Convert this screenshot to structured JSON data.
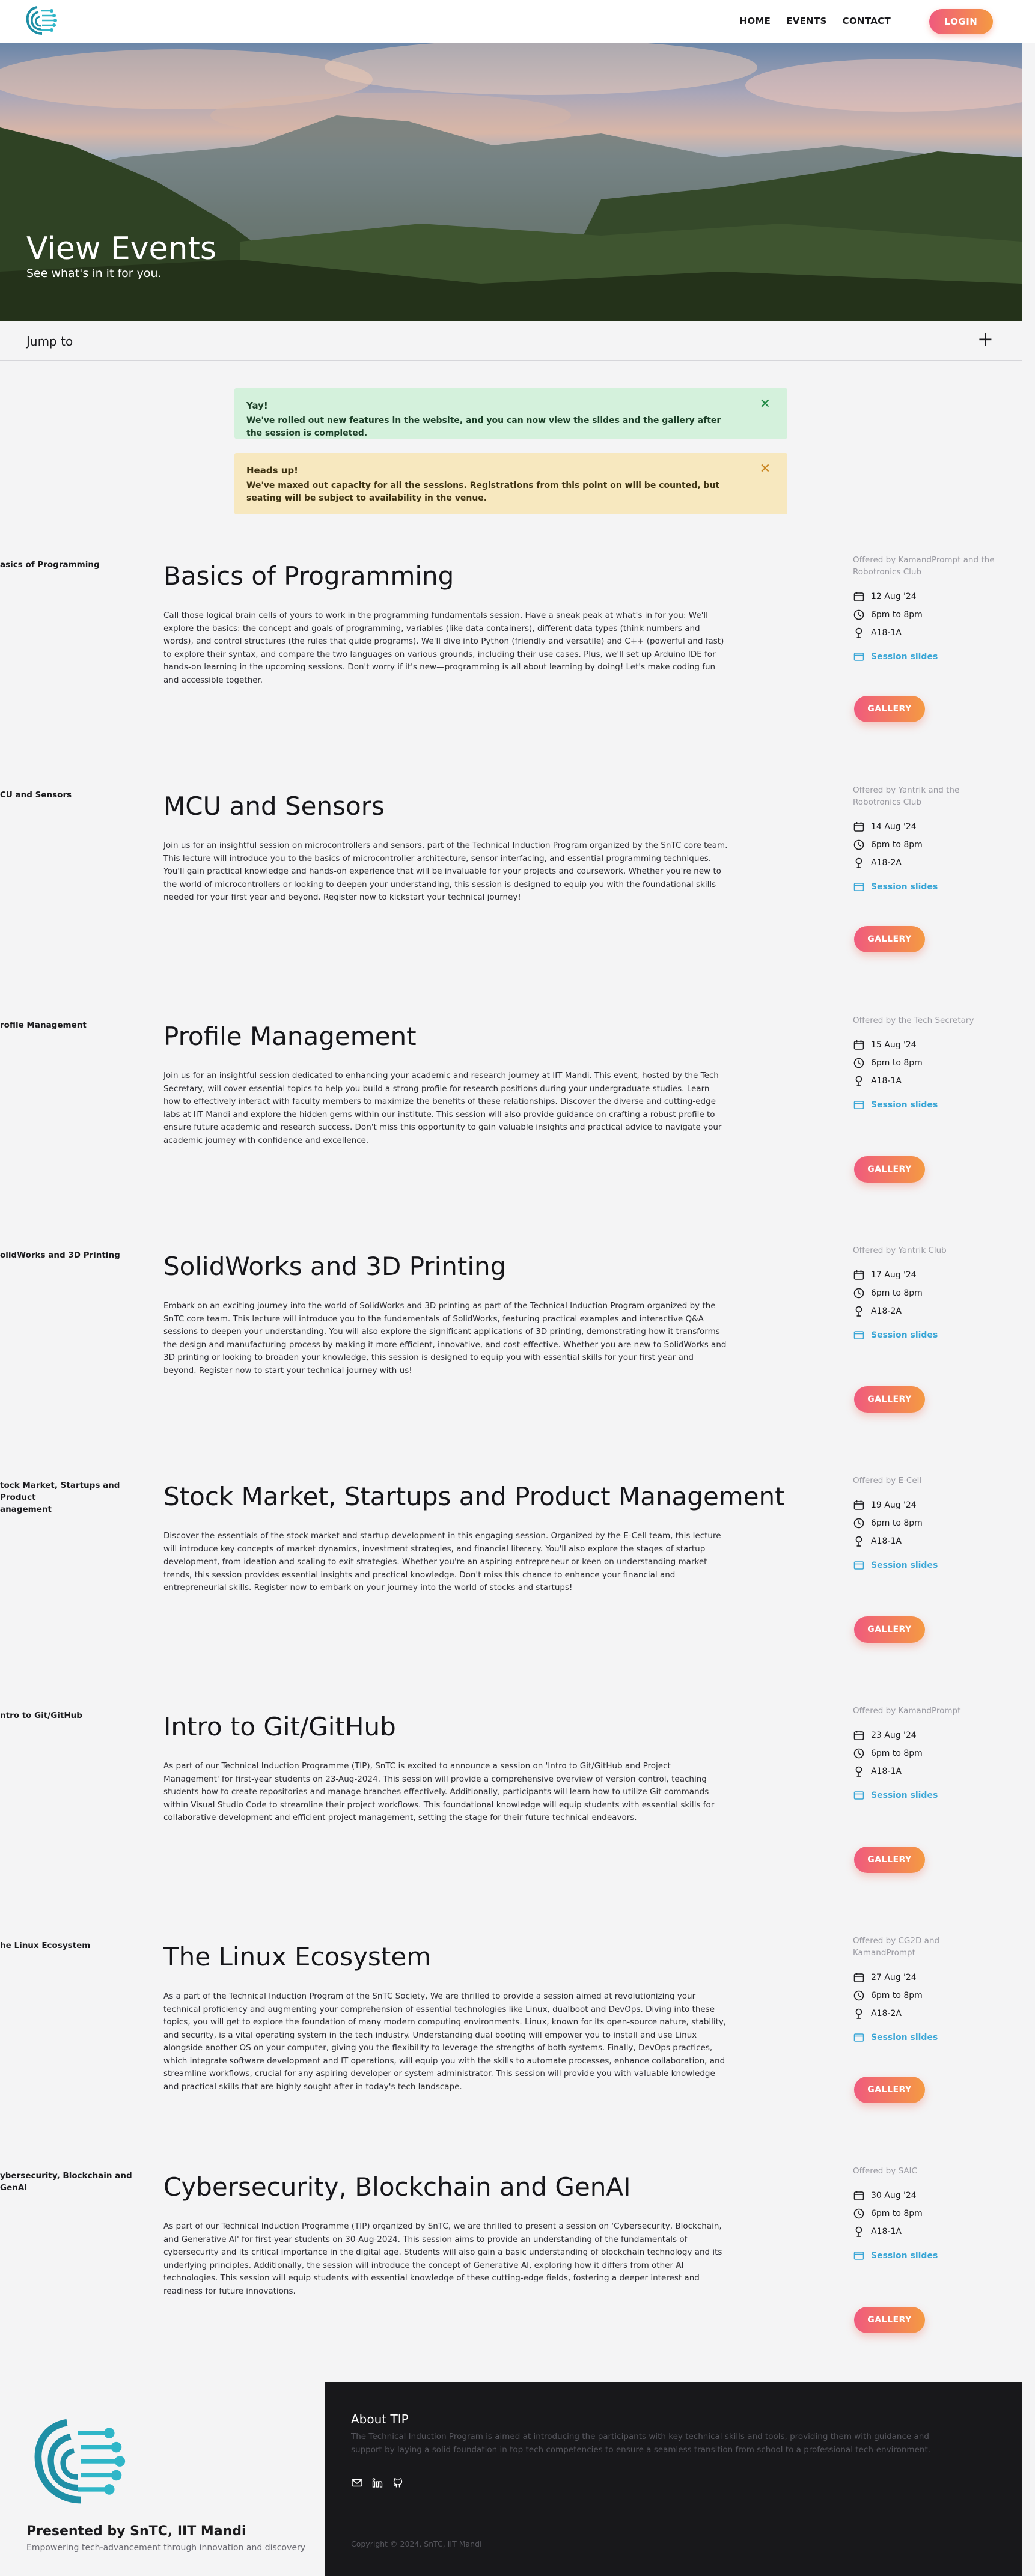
{
  "nav": {
    "links": [
      "HOME",
      "EVENTS",
      "CONTACT"
    ],
    "login_label": "LOGIN"
  },
  "hero": {
    "title": "View Events",
    "subtitle": "See what's in it for you."
  },
  "jump": {
    "label": "Jump to",
    "toggle": "+"
  },
  "alerts": {
    "success": {
      "title": "Yay!",
      "text": "We've rolled out new features in the website, and you can now view the slides and the gallery after the session is completed.",
      "close": "✕"
    },
    "warning": {
      "title": "Heads up!",
      "text": "We've maxed out capacity for all the sessions. Registrations from this point on will be counted, but seating will be subject to availability in the venue.",
      "close": "✕"
    }
  },
  "sessions": [
    {
      "side_label": "asics of Programming",
      "title": "Basics of Programming",
      "description": "Call those logical brain cells of yours to work in the programming fundamentals session. Have a sneak peak at what's in for you: We'll explore the basics: the concept and goals of programming, variables (like data containers), different data types (think numbers and words), and control structures (the rules that guide programs). We'll dive into Python (friendly and versatile) and C++ (powerful and fast) to explore their syntax, and compare the two languages on various grounds, including their use cases. Plus, we'll set up Arduino IDE for hands-on learning in the upcoming sessions. Don't worry if it's new—programming is all about learning by doing! Let's make coding fun and accessible together.",
      "offered_by": "Offered by KamandPrompt and the Robotronics Club",
      "date": "12 Aug '24",
      "time": "6pm to 8pm",
      "venue": "A18-1A",
      "slides_label": "Session slides",
      "gallery_label": "GALLERY"
    },
    {
      "side_label": "CU and Sensors",
      "title": "MCU and Sensors",
      "description": "Join us for an insightful session on microcontrollers and sensors, part of the Technical Induction Program organized by the SnTC core team. This lecture will introduce you to the basics of microcontroller architecture, sensor interfacing, and essential programming techniques. You'll gain practical knowledge and hands-on experience that will be invaluable for your projects and coursework. Whether you're new to the world of microcontrollers or looking to deepen your understanding, this session is designed to equip you with the foundational skills needed for your first year and beyond. Register now to kickstart your technical journey!",
      "offered_by": "Offered by Yantrik and the Robotronics Club",
      "date": "14 Aug '24",
      "time": "6pm to 8pm",
      "venue": "A18-2A",
      "slides_label": "Session slides",
      "gallery_label": "GALLERY"
    },
    {
      "side_label": "rofile Management",
      "title": "Profile Management",
      "description": "Join us for an insightful session dedicated to enhancing your academic and research journey at IIT Mandi. This event, hosted by the Tech Secretary, will cover essential topics to help you build a strong profile for research positions during your undergraduate studies. Learn how to effectively interact with faculty members to maximize the benefits of these relationships. Discover the diverse and cutting-edge labs at IIT Mandi and explore the hidden gems within our institute. This session will also provide guidance on crafting a robust profile to ensure future academic and research success. Don't miss this opportunity to gain valuable insights and practical advice to navigate your academic journey with confidence and excellence.",
      "offered_by": "Offered by the Tech Secretary",
      "date": "15 Aug '24",
      "time": "6pm to 8pm",
      "venue": "A18-1A",
      "slides_label": "Session slides",
      "gallery_label": "GALLERY"
    },
    {
      "side_label": "olidWorks and 3D Printing",
      "title": "SolidWorks and 3D Printing",
      "description": "Embark on an exciting journey into the world of SolidWorks and 3D printing as part of the Technical Induction Program organized by the SnTC core team. This lecture will introduce you to the fundamentals of SolidWorks, featuring practical examples and interactive Q&A sessions to deepen your understanding. You will also explore the significant applications of 3D printing, demonstrating how it transforms the design and manufacturing process by making it more efficient, innovative, and cost-effective. Whether you are new to SolidWorks and 3D printing or looking to broaden your knowledge, this session is designed to equip you with essential skills for your first year and beyond. Register now to start your technical journey with us!",
      "offered_by": "Offered by Yantrik Club",
      "date": "17 Aug '24",
      "time": "6pm to 8pm",
      "venue": "A18-2A",
      "slides_label": "Session slides",
      "gallery_label": "GALLERY"
    },
    {
      "side_label": "tock Market, Startups and Product\nanagement",
      "title": "Stock Market, Startups and Product Management",
      "description": "Discover the essentials of the stock market and startup development in this engaging session. Organized by the E-Cell team, this lecture will introduce key concepts of market dynamics, investment strategies, and financial literacy. You'll also explore the stages of startup development, from ideation and scaling to exit strategies. Whether you're an aspiring entrepreneur or keen on understanding market trends, this session provides essential insights and practical knowledge. Don't miss this chance to enhance your financial and entrepreneurial skills. Register now to embark on your journey into the world of stocks and startups!",
      "offered_by": "Offered by E-Cell",
      "date": "19 Aug '24",
      "time": "6pm to 8pm",
      "venue": "A18-1A",
      "slides_label": "Session slides",
      "gallery_label": "GALLERY"
    },
    {
      "side_label": "ntro to Git/GitHub",
      "title": "Intro to Git/GitHub",
      "description": "As part of our Technical Induction Programme (TIP), SnTC is excited to announce a session on 'Intro to Git/GitHub and Project Management' for first-year students on 23-Aug-2024. This session will provide a comprehensive overview of version control, teaching students how to create repositories and manage branches effectively. Additionally, participants will learn how to utilize Git commands within Visual Studio Code to streamline their project workflows. This foundational knowledge will equip students with essential skills for collaborative development and efficient project management, setting the stage for their future technical endeavors.",
      "offered_by": "Offered by KamandPrompt",
      "date": "23 Aug '24",
      "time": "6pm to 8pm",
      "venue": "A18-1A",
      "slides_label": "Session slides",
      "gallery_label": "GALLERY"
    },
    {
      "side_label": "he Linux Ecosystem",
      "title": "The Linux Ecosystem",
      "description": "As a part of the Technical Induction Program of the SnTC Society, We are thrilled to provide a session aimed at revolutionizing your technical proficiency and augmenting your comprehension of essential technologies like Linux, dualboot and DevOps. Diving into these topics, you will get to explore the foundation of many modern computing environments. Linux, known for its open-source nature, stability, and security, is a vital operating system in the tech industry. Understanding dual booting will empower you to install and use Linux alongside another OS on your computer, giving you the flexibility to leverage the strengths of both systems. Finally, DevOps practices, which integrate software development and IT operations, will equip you with the skills to automate processes, enhance collaboration, and streamline workflows, crucial for any aspiring developer or system administrator. This session will provide you with valuable knowledge and practical skills that are highly sought after in today's tech landscape.",
      "offered_by": "Offered by CG2D and KamandPrompt",
      "date": "27 Aug '24",
      "time": "6pm to 8pm",
      "venue": "A18-2A",
      "slides_label": "Session slides",
      "gallery_label": "GALLERY"
    },
    {
      "side_label": "ybersecurity, Blockchain and GenAI",
      "title": "Cybersecurity, Blockchain and GenAI",
      "description": "As part of our Technical Induction Programme (TIP) organized by SnTC, we are thrilled to present a session on 'Cybersecurity, Blockchain, and Generative AI' for first-year students on 30-Aug-2024. This session aims to provide an understanding of the fundamentals of cybersecurity and its critical importance in the digital age. Students will also gain a basic understanding of blockchain technology and its underlying principles. Additionally, the session will introduce the concept of Generative AI, exploring how it differs from other AI technologies. This session will equip students with essential knowledge of these cutting-edge fields, fostering a deeper interest and readiness for future innovations.",
      "offered_by": "Offered by SAIC",
      "date": "30 Aug '24",
      "time": "6pm to 8pm",
      "venue": "A18-1A",
      "slides_label": "Session slides",
      "gallery_label": "GALLERY"
    }
  ],
  "footer": {
    "org_name": "Presented by SnTC, IIT Mandi",
    "tagline": "Empowering tech-advancement through innovation and discovery",
    "about_title": "About TIP",
    "about_text": "The Technical Induction Program is aimed at introducing the participants with key technical skills and tools, providing them with guidance and support by laying a solid foundation in top tech competencies to ensure a seamless transition from school to a professional tech-environment.",
    "socials": [
      "mail-icon",
      "linkedin-icon",
      "github-icon"
    ],
    "copyright": "Copyright © 2024, SnTC, IIT Mandi"
  },
  "colors": {
    "accent_gradient_start": "#f05a7e",
    "accent_gradient_end": "#f59a42",
    "link": "#3aa6d6",
    "success_bg": "#d4f1dc",
    "warning_bg": "#f7e8bf",
    "footer_bg": "#18181b"
  }
}
